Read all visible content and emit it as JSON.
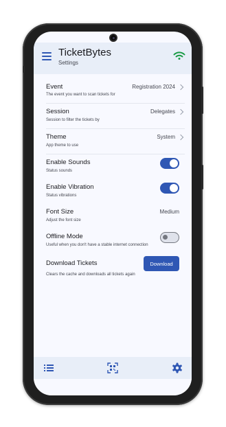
{
  "app": {
    "title": "TicketBytes",
    "subtitle": "Settings",
    "accent_color": "#2f57b4",
    "wifi_color": "#1a9b45"
  },
  "icons": {
    "menu": "menu-icon",
    "wifi": "wifi-icon",
    "list": "list-icon",
    "qr": "qr-scan-icon",
    "settings": "gear-icon"
  },
  "settings": {
    "event": {
      "title": "Event",
      "description": "The event you want to scan tickets for",
      "value": "Registration 2024"
    },
    "session": {
      "title": "Session",
      "description": "Session to filter the tickets by",
      "value": "Delegates"
    },
    "theme": {
      "title": "Theme",
      "description": "App theme to use",
      "value": "System"
    },
    "sounds": {
      "title": "Enable Sounds",
      "description": "Status sounds",
      "enabled": true
    },
    "vibration": {
      "title": "Enable Vibration",
      "description": "Status vibrations",
      "enabled": true
    },
    "font_size": {
      "title": "Font Size",
      "description": "Adjust the font size",
      "value": "Medium"
    },
    "offline": {
      "title": "Offline Mode",
      "description": "Useful when you don't have a stable internet connection",
      "enabled": false
    },
    "download": {
      "title": "Download Tickets",
      "description": "Clears the cache and downloads all tickets again",
      "button_label": "Download"
    }
  }
}
